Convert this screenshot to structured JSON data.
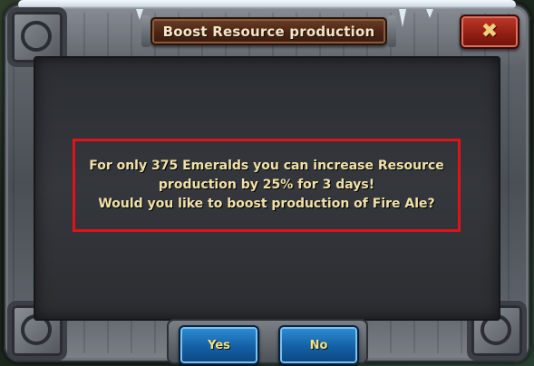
{
  "dialog": {
    "title": "Boost Resource production",
    "close_label": "✖"
  },
  "message": {
    "lines": [
      "For only 375 Emeralds you can increase Resource",
      "production by 25% for 3 days!",
      "Would you like to boost production of Fire Ale?"
    ]
  },
  "buttons": {
    "yes_label": "Yes",
    "no_label": "No"
  },
  "colors": {
    "highlight_border": "#e0121a",
    "message_text": "#f1e2a8",
    "button_blue": "#145fa5",
    "button_text": "#f6e07a",
    "close_red": "#8e1d12"
  }
}
